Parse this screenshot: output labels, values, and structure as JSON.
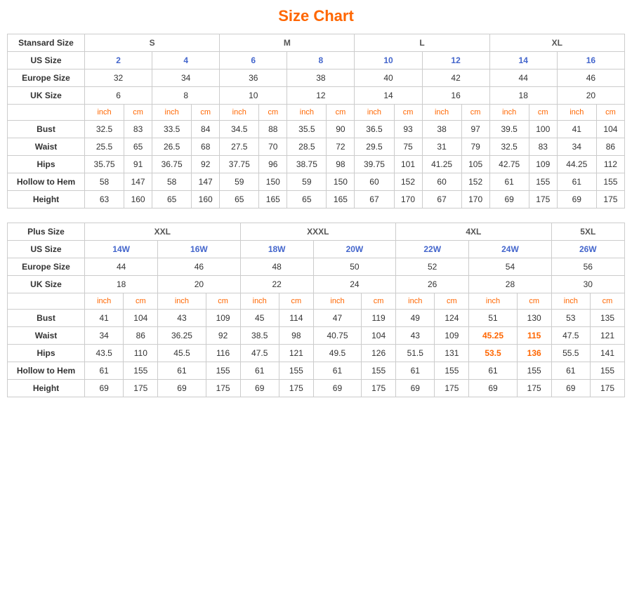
{
  "title": "Size Chart",
  "standard": {
    "label": "Stansard Size",
    "sizes": [
      "S",
      "M",
      "L",
      "XL"
    ],
    "us_size_label": "US Size",
    "europe_size_label": "Europe Size",
    "uk_size_label": "UK Size",
    "us_sizes": [
      "2",
      "4",
      "6",
      "8",
      "10",
      "12",
      "14",
      "16"
    ],
    "europe_sizes": [
      "32",
      "34",
      "36",
      "38",
      "40",
      "42",
      "44",
      "46"
    ],
    "uk_sizes": [
      "6",
      "8",
      "10",
      "12",
      "14",
      "16",
      "18",
      "20"
    ],
    "unit_labels": [
      "inch",
      "cm",
      "inch",
      "cm",
      "inch",
      "cm",
      "inch",
      "cm",
      "inch",
      "cm",
      "inch",
      "cm",
      "inch",
      "cm",
      "inch",
      "cm"
    ],
    "measurements": {
      "bust_label": "Bust",
      "bust": [
        "32.5",
        "83",
        "33.5",
        "84",
        "34.5",
        "88",
        "35.5",
        "90",
        "36.5",
        "93",
        "38",
        "97",
        "39.5",
        "100",
        "41",
        "104"
      ],
      "waist_label": "Waist",
      "waist": [
        "25.5",
        "65",
        "26.5",
        "68",
        "27.5",
        "70",
        "28.5",
        "72",
        "29.5",
        "75",
        "31",
        "79",
        "32.5",
        "83",
        "34",
        "86"
      ],
      "hips_label": "Hips",
      "hips": [
        "35.75",
        "91",
        "36.75",
        "92",
        "37.75",
        "96",
        "38.75",
        "98",
        "39.75",
        "101",
        "41.25",
        "105",
        "42.75",
        "109",
        "44.25",
        "112"
      ],
      "hollow_label": "Hollow to Hem",
      "hollow": [
        "58",
        "147",
        "58",
        "147",
        "59",
        "150",
        "59",
        "150",
        "60",
        "152",
        "60",
        "152",
        "61",
        "155",
        "61",
        "155"
      ],
      "height_label": "Height",
      "height": [
        "63",
        "160",
        "65",
        "160",
        "65",
        "165",
        "65",
        "165",
        "67",
        "170",
        "67",
        "170",
        "69",
        "175",
        "69",
        "175"
      ]
    }
  },
  "plus": {
    "label": "Plus Size",
    "sizes": [
      "XXL",
      "XXXL",
      "4XL",
      "5XL"
    ],
    "us_size_label": "US Size",
    "europe_size_label": "Europe Size",
    "uk_size_label": "UK Size",
    "us_sizes": [
      "14W",
      "16W",
      "18W",
      "20W",
      "22W",
      "24W",
      "26W"
    ],
    "europe_sizes": [
      "44",
      "46",
      "48",
      "50",
      "52",
      "54",
      "56"
    ],
    "uk_sizes": [
      "18",
      "20",
      "22",
      "24",
      "26",
      "28",
      "30"
    ],
    "unit_labels": [
      "inch",
      "cm",
      "inch",
      "cm",
      "inch",
      "cm",
      "inch",
      "cm",
      "inch",
      "cm",
      "inch",
      "cm",
      "inch",
      "cm"
    ],
    "measurements": {
      "bust_label": "Bust",
      "bust": [
        "41",
        "104",
        "43",
        "109",
        "45",
        "114",
        "47",
        "119",
        "49",
        "124",
        "51",
        "130",
        "53",
        "135"
      ],
      "waist_label": "Waist",
      "waist": [
        "34",
        "86",
        "36.25",
        "92",
        "38.5",
        "98",
        "40.75",
        "104",
        "43",
        "109",
        "45.25",
        "115",
        "47.5",
        "121"
      ],
      "hips_label": "Hips",
      "hips": [
        "43.5",
        "110",
        "45.5",
        "116",
        "47.5",
        "121",
        "49.5",
        "126",
        "51.5",
        "131",
        "53.5",
        "136",
        "55.5",
        "141"
      ],
      "hollow_label": "Hollow to Hem",
      "hollow": [
        "61",
        "155",
        "61",
        "155",
        "61",
        "155",
        "61",
        "155",
        "61",
        "155",
        "61",
        "155",
        "61",
        "155"
      ],
      "height_label": "Height",
      "height": [
        "69",
        "175",
        "69",
        "175",
        "69",
        "175",
        "69",
        "175",
        "69",
        "175",
        "69",
        "175",
        "69",
        "175"
      ]
    }
  }
}
